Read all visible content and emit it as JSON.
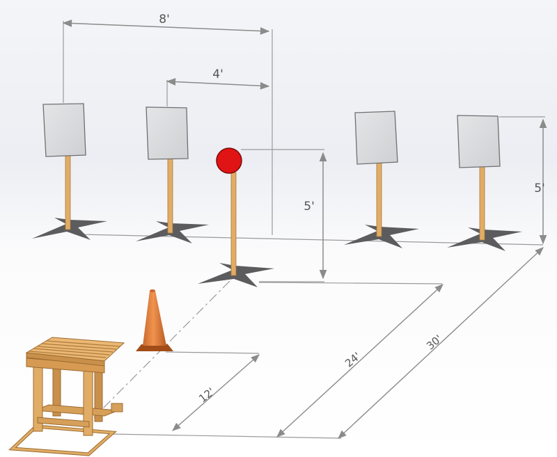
{
  "dimensions": {
    "target_spacing": "8'",
    "stand_spacing": "4'",
    "popper_height": "5'",
    "target_height": "5'",
    "cone_distance": "12'",
    "popper_distance": "24'",
    "target_distance": "30'"
  },
  "colors": {
    "background_top": "#eef0f5",
    "background_bottom": "#ffffff",
    "target_face": "#d9dadc",
    "wood": "#e1ad66",
    "wood_dark": "#a9763a",
    "base": "#5e5e60",
    "popper": "#e01414",
    "cone": "#dd7a36",
    "dimension_line": "#8b8b8b"
  }
}
